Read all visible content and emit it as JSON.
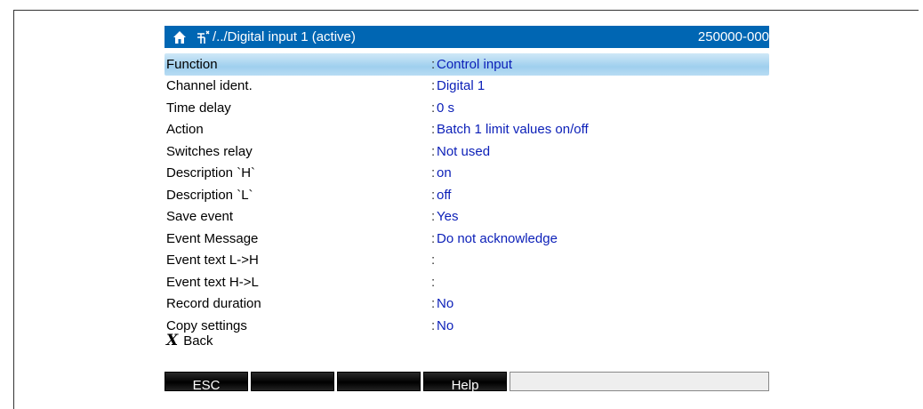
{
  "titlebar": {
    "path": "/../Digital input 1 (active)",
    "code": "250000-000"
  },
  "rows": [
    {
      "label": "Function",
      "value": "Control input",
      "selected": true
    },
    {
      "label": "Channel ident.",
      "value": "Digital 1"
    },
    {
      "label": "Time delay",
      "value": "0 s"
    },
    {
      "label": "Action",
      "value": "Batch 1 limit values on/off"
    },
    {
      "label": "Switches relay",
      "value": "Not used"
    },
    {
      "label": "Description `H`",
      "value": "on"
    },
    {
      "label": "Description `L`",
      "value": "off"
    },
    {
      "label": "Save event",
      "value": "Yes"
    },
    {
      "label": "Event Message",
      "value": "Do not acknowledge"
    },
    {
      "label": "Event text L->H",
      "value": ""
    },
    {
      "label": "Event text H->L",
      "value": ""
    },
    {
      "label": "Record duration",
      "value": "No"
    },
    {
      "label": "Copy settings",
      "value": "No"
    }
  ],
  "back_label": "Back",
  "softkeys": [
    "ESC",
    "",
    "",
    "Help",
    ""
  ],
  "colors": {
    "titlebar": "#0066b3",
    "value_text": "#0b1fb8",
    "selected_row": "#9fcfee"
  }
}
